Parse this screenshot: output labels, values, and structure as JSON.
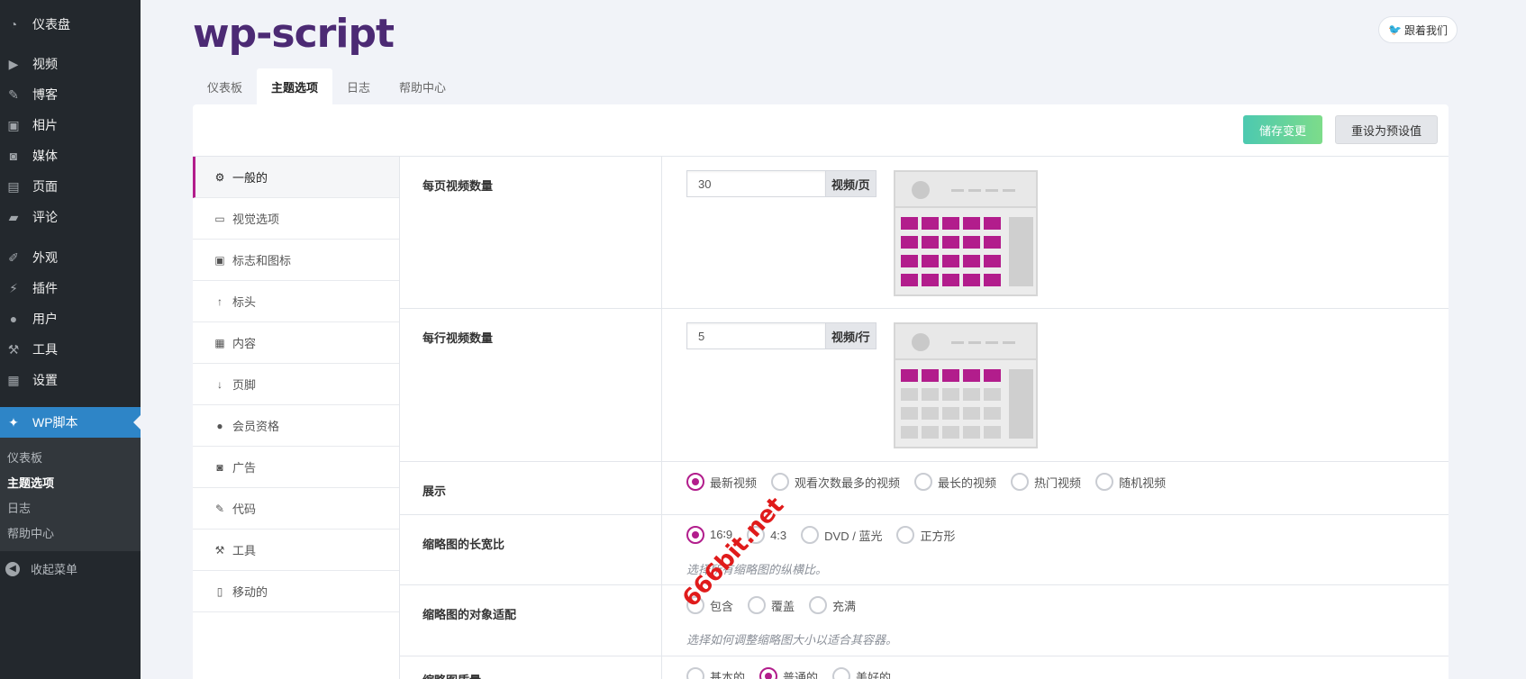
{
  "wp_menu": {
    "items": [
      {
        "label": "仪表盘",
        "icon": "dashboard-icon"
      },
      {
        "label": "视频",
        "icon": "video-icon"
      },
      {
        "label": "博客",
        "icon": "pin-icon"
      },
      {
        "label": "相片",
        "icon": "photo-icon"
      },
      {
        "label": "媒体",
        "icon": "media-icon"
      },
      {
        "label": "页面",
        "icon": "page-icon"
      },
      {
        "label": "评论",
        "icon": "comment-icon"
      },
      {
        "label": "外观",
        "icon": "brush-icon"
      },
      {
        "label": "插件",
        "icon": "plugin-icon"
      },
      {
        "label": "用户",
        "icon": "user-icon"
      },
      {
        "label": "工具",
        "icon": "wrench-icon"
      },
      {
        "label": "设置",
        "icon": "settings-icon"
      },
      {
        "label": "WP脚本",
        "icon": "wpscript-icon"
      }
    ],
    "submenu": [
      "仪表板",
      "主题选项",
      "日志",
      "帮助中心"
    ],
    "collapse_label": "收起菜单"
  },
  "header": {
    "logo_text": "wp-script",
    "twitter_label": "跟着我们"
  },
  "tabs": [
    "仪表板",
    "主题选项",
    "日志",
    "帮助中心"
  ],
  "toolbar": {
    "save_label": "储存变更",
    "reset_label": "重设为预设值"
  },
  "left_nav": [
    {
      "label": "一般的",
      "icon": "gear-icon",
      "glyph": "⚙"
    },
    {
      "label": "视觉选项",
      "icon": "monitor-icon",
      "glyph": "▭"
    },
    {
      "label": "标志和图标",
      "icon": "image-icon",
      "glyph": "▣"
    },
    {
      "label": "标头",
      "icon": "arrow-up-icon",
      "glyph": "↑"
    },
    {
      "label": "内容",
      "icon": "grid-icon",
      "glyph": "▦"
    },
    {
      "label": "页脚",
      "icon": "arrow-down-icon",
      "glyph": "↓"
    },
    {
      "label": "会员资格",
      "icon": "user-icon",
      "glyph": "●"
    },
    {
      "label": "广告",
      "icon": "money-icon",
      "glyph": "◙"
    },
    {
      "label": "代码",
      "icon": "pencil-icon",
      "glyph": "✎"
    },
    {
      "label": "工具",
      "icon": "wrench-icon",
      "glyph": "⚒"
    },
    {
      "label": "移动的",
      "icon": "mobile-icon",
      "glyph": "▯"
    }
  ],
  "options": {
    "videos_per_page": {
      "label": "每页视频数量",
      "value": "30",
      "unit": "视频/页"
    },
    "videos_per_row": {
      "label": "每行视频数量",
      "value": "5",
      "unit": "视频/行"
    },
    "display": {
      "label": "展示",
      "choices": [
        "最新视频",
        "观看次数最多的视频",
        "最长的视频",
        "热门视频",
        "随机视频"
      ],
      "selected": 0
    },
    "aspect_ratio": {
      "label": "缩略图的长宽比",
      "choices": [
        "16∶9",
        "4:3",
        "DVD / 蓝光",
        "正方形"
      ],
      "selected": 0,
      "hint": "选择所有缩略图的纵横比。"
    },
    "object_fit": {
      "label": "缩略图的对象适配",
      "choices": [
        "包含",
        "覆盖",
        "充满"
      ],
      "selected": -1,
      "hint": "选择如何调整缩略图大小以适合其容器。"
    },
    "partial": {
      "label": "缩略图质量",
      "choices": [
        "基本的",
        "普通的",
        "美好的"
      ],
      "selected": 1
    }
  },
  "accent_color": "#b21d8c",
  "watermark": "666bit.net"
}
